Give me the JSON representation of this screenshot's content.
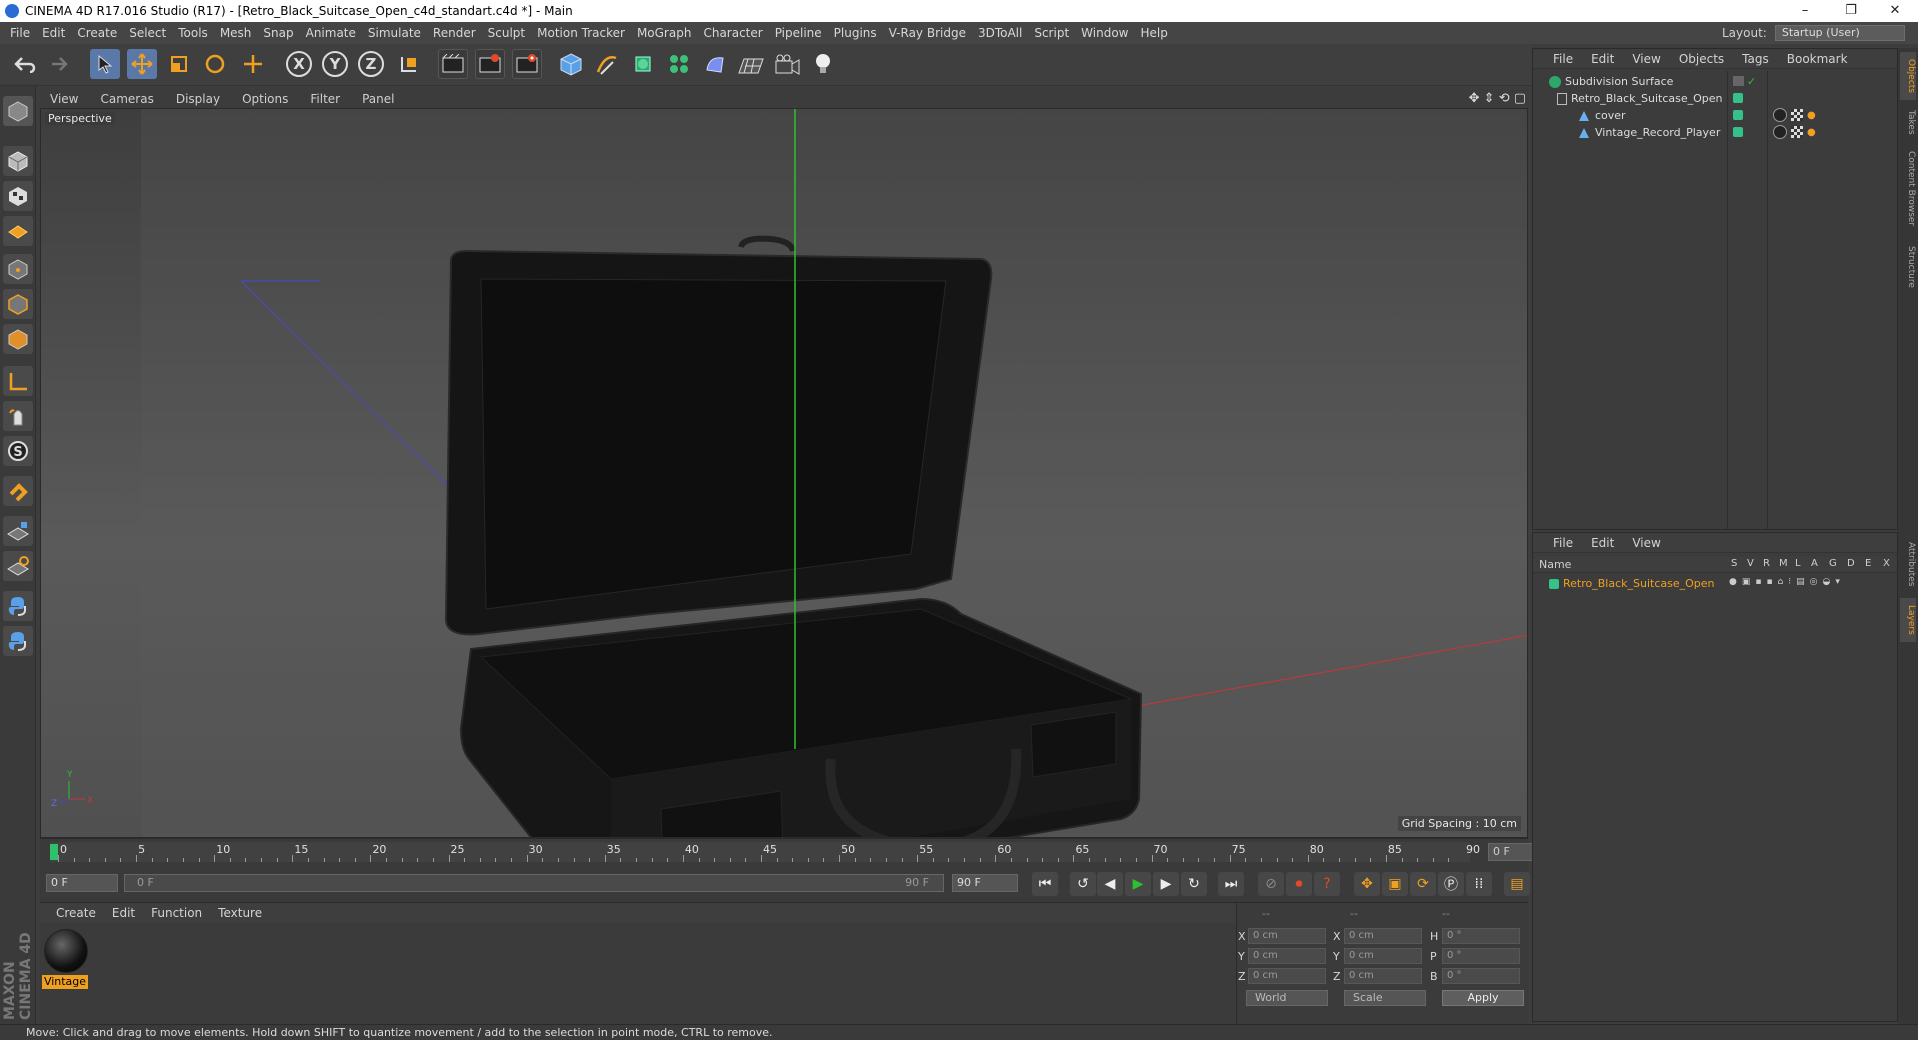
{
  "window": {
    "title": "CINEMA 4D R17.016 Studio (R17) - [Retro_Black_Suitcase_Open_c4d_standart.c4d *] - Main",
    "controls": [
      "–",
      "❐",
      "✕"
    ]
  },
  "menu": [
    "File",
    "Edit",
    "Create",
    "Select",
    "Tools",
    "Mesh",
    "Snap",
    "Animate",
    "Simulate",
    "Render",
    "Sculpt",
    "Motion Tracker",
    "MoGraph",
    "Character",
    "Pipeline",
    "Plugins",
    "V-Ray Bridge",
    "3DToAll",
    "Script",
    "Window",
    "Help"
  ],
  "layout": {
    "label": "Layout:",
    "value": "Startup (User)"
  },
  "toolbar": {
    "axis_x": "X",
    "axis_y": "Y",
    "axis_z": "Z"
  },
  "viewport": {
    "menu": [
      "View",
      "Cameras",
      "Display",
      "Options",
      "Filter",
      "Panel"
    ],
    "label": "Perspective",
    "grid_spacing": "Grid Spacing : 10 cm",
    "axis_labels": {
      "x": "X",
      "y": "Y",
      "z": "Z"
    }
  },
  "timeline": {
    "ticks": [
      "0",
      "5",
      "10",
      "15",
      "20",
      "25",
      "30",
      "35",
      "40",
      "45",
      "50",
      "55",
      "60",
      "65",
      "70",
      "75",
      "80",
      "85",
      "90"
    ],
    "current_frame": "0 F"
  },
  "playback": {
    "start": "0 F",
    "range_start": "0 F",
    "range_end": "90 F",
    "end": "90 F"
  },
  "materials": {
    "menu": [
      "Create",
      "Edit",
      "Function",
      "Texture"
    ],
    "items": [
      {
        "name": "Vintage"
      }
    ]
  },
  "coords": {
    "headers": [
      "--",
      "--",
      "--"
    ],
    "rows": [
      {
        "a": "X",
        "av": "0 cm",
        "b": "X",
        "bv": "0 cm",
        "c": "H",
        "cv": "0 °"
      },
      {
        "a": "Y",
        "av": "0 cm",
        "b": "Y",
        "bv": "0 cm",
        "c": "P",
        "cv": "0 °"
      },
      {
        "a": "Z",
        "av": "0 cm",
        "b": "Z",
        "bv": "0 cm",
        "c": "B",
        "cv": "0 °"
      }
    ],
    "mode1": "World",
    "mode2": "Scale",
    "apply": "Apply"
  },
  "objects": {
    "menu": [
      "File",
      "Edit",
      "View",
      "Objects",
      "Tags",
      "Bookmark"
    ],
    "tree": [
      {
        "name": "Subdivision Surface"
      },
      {
        "name": "Retro_Black_Suitcase_Open"
      },
      {
        "name": "cover"
      },
      {
        "name": "Vintage_Record_Player"
      }
    ]
  },
  "layers": {
    "menu": [
      "File",
      "Edit",
      "View"
    ],
    "header_name": "Name",
    "header_cols": [
      "S",
      "V",
      "R",
      "M",
      "L",
      "A",
      "G",
      "D",
      "E",
      "X"
    ],
    "rows": [
      {
        "name": "Retro_Black_Suitcase_Open",
        "color": "#34c28a"
      }
    ]
  },
  "side_tabs": [
    "Objects",
    "Takes",
    "Content Browser",
    "Structure",
    "Attributes",
    "Layers"
  ],
  "status": "Move: Click and drag to move elements. Hold down SHIFT to quantize movement / add to the selection in point mode, CTRL to remove.",
  "brand": "MAXON CINEMA 4D",
  "colors": {
    "accent": "#f0a020",
    "selection": "#5a79a8",
    "layer_green": "#34c28a"
  }
}
